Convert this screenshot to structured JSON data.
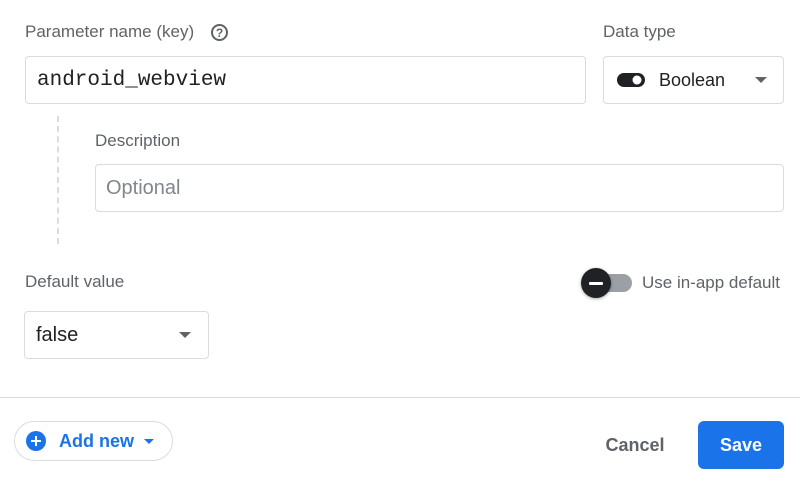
{
  "parameter": {
    "key_label": "Parameter name (key)",
    "key_value": "android_webview",
    "help_glyph": "?"
  },
  "data_type": {
    "label": "Data type",
    "selected": "Boolean",
    "icon": "toggle-icon"
  },
  "description": {
    "label": "Description",
    "placeholder": "Optional",
    "value": ""
  },
  "default_value": {
    "label": "Default value",
    "selected": "false",
    "use_in_app_default_label": "Use in-app default",
    "use_in_app_default_checked": false
  },
  "footer": {
    "add_new_label": "Add new",
    "cancel_label": "Cancel",
    "save_label": "Save"
  },
  "colors": {
    "accent": "#1a73e8",
    "text": "#3c4043",
    "muted": "#5f6368",
    "border": "#dadce0"
  }
}
